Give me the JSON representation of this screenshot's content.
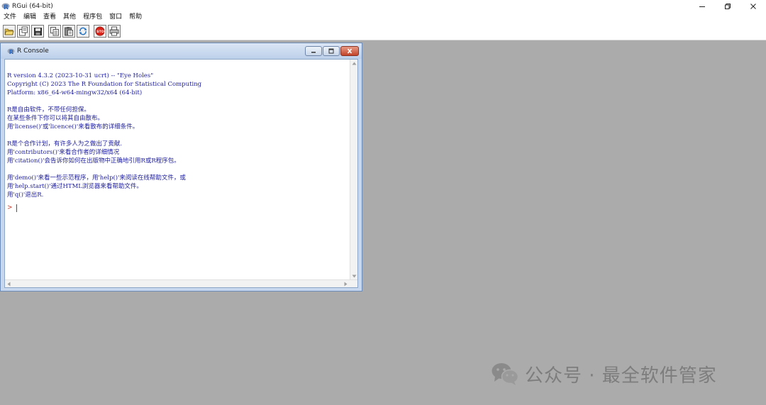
{
  "window": {
    "title": "RGui (64-bit)",
    "controls": [
      "minimize",
      "maximize",
      "close"
    ]
  },
  "menubar": {
    "items": [
      "文件",
      "编辑",
      "查看",
      "其他",
      "程序包",
      "窗口",
      "帮助"
    ]
  },
  "toolbar": {
    "buttons": [
      "open-script-icon",
      "load-workspace-icon",
      "save-workspace-icon",
      "copy-icon",
      "paste-icon",
      "copy-paste-icon",
      "stop-icon",
      "print-icon"
    ]
  },
  "console": {
    "title": "R Console",
    "lines": [
      "R version 4.3.2 (2023-10-31 ucrt) -- \"Eye Holes\"",
      "Copyright (C) 2023 The R Foundation for Statistical Computing",
      "Platform: x86_64-w64-mingw32/x64 (64-bit)",
      "",
      "R是自由软件，不带任何担保。",
      "在某些条件下你可以将其自由散布。",
      "用'license()'或'licence()'来看散布的详细条件。",
      "",
      "R是个合作计划，有许多人为之做出了贡献.",
      "用'contributors()'来看合作者的详细情况",
      "用'citation()'会告诉你如何在出版物中正确地引用R或R程序包。",
      "",
      "用'demo()'来看一些示范程序，用'help()'来阅读在线帮助文件，或",
      "用'help.start()'通过HTML浏览器来看帮助文件。",
      "用'q()'退出R."
    ],
    "prompt": ">"
  },
  "watermark": {
    "text": "公众号 · 最全软件管家"
  },
  "colors": {
    "desktop_bg": "#ababab",
    "console_text": "#1d1d9e",
    "prompt": "#d23c2a",
    "stop_button": "#d8241a"
  }
}
